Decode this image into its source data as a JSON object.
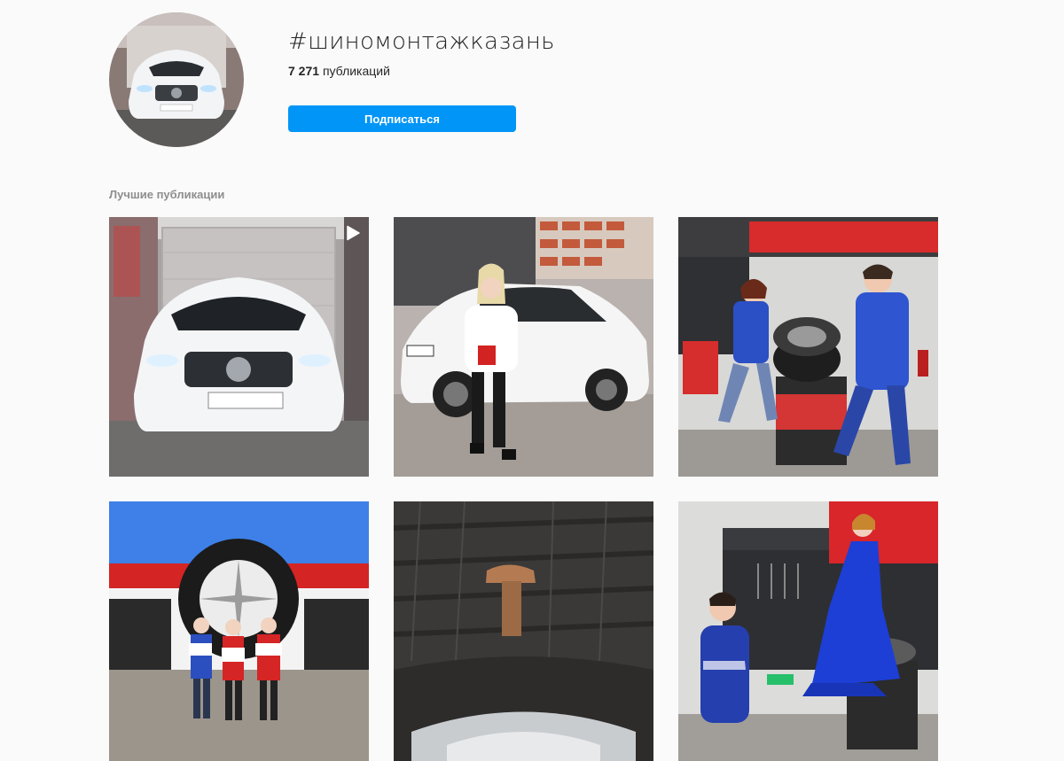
{
  "header": {
    "hashtag": "#шиномонтажказань",
    "post_count": "7 271",
    "post_count_label": "публикаций",
    "follow_label": "Подписаться"
  },
  "top_posts": {
    "title": "Лучшие публикации",
    "posts": [
      {
        "content": "white-mercedes-in-garage",
        "is_video": true
      },
      {
        "content": "woman-beside-white-car"
      },
      {
        "content": "tire-change-workshop"
      },
      {
        "content": "tire-shop-staff-with-signs"
      },
      {
        "content": "nail-in-tire"
      },
      {
        "content": "model-in-blue-dress-at-tire-shop"
      }
    ]
  },
  "colors": {
    "accent": "#0095f6",
    "background": "#fafafa",
    "text": "#262626",
    "muted": "#8e8e8e"
  }
}
